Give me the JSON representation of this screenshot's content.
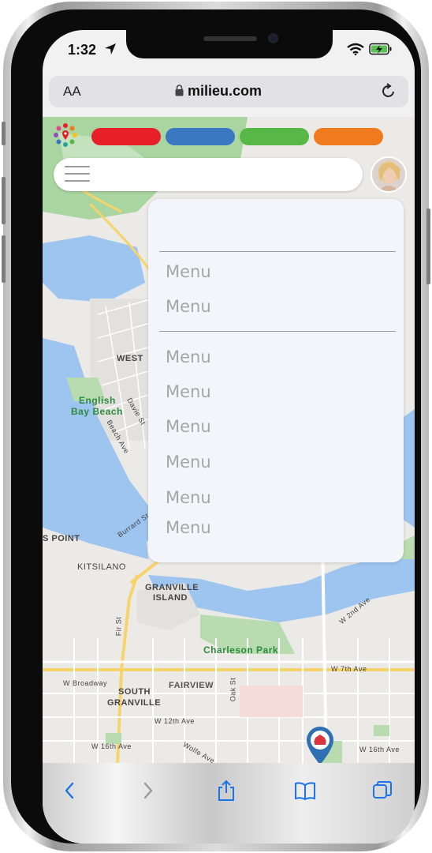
{
  "status_bar": {
    "time": "1:32",
    "icons": [
      "location-arrow-icon",
      "wifi-icon",
      "battery-charging-icon"
    ]
  },
  "browser": {
    "text_size_label": "AA",
    "url": "milieu.com",
    "icons": [
      "lock-icon",
      "reload-icon"
    ]
  },
  "app_header": {
    "logo": "milieu-logo",
    "category_tabs": [
      {
        "name": "red-tab",
        "color": "#e8202a"
      },
      {
        "name": "blue-tab",
        "color": "#3a78c2"
      },
      {
        "name": "green-tab",
        "color": "#58b847"
      },
      {
        "name": "orange-tab",
        "color": "#f07a1e"
      }
    ],
    "search_placeholder": "",
    "menu_icon": "hamburger-icon",
    "avatar": "user-avatar"
  },
  "dropdown_menu": {
    "group_1": [
      "Menu",
      "Menu"
    ],
    "group_2": [
      "Menu",
      "Menu",
      "Menu",
      "Menu",
      "Menu",
      "Menu"
    ]
  },
  "map": {
    "labels": [
      "WEST",
      "English",
      "Bay Beach",
      "Davie St",
      "Beach Ave",
      "S POINT",
      "KITSILANO",
      "Burrard St",
      "GRANVILLE",
      "ISLAND",
      "Charleson Park",
      "W Broadway",
      "SOUTH",
      "GRANVILLE",
      "FAIRVIEW",
      "W 7th Ave",
      "W 12th Ave",
      "W 16th Ave",
      "Wolfe Ave",
      "Oak St",
      "W 2nd Ave",
      "W 16th Ave",
      "Fir St"
    ],
    "marker": "map-pin-icon"
  },
  "toolbar": {
    "icons": [
      "back-icon",
      "forward-icon",
      "share-icon",
      "bookmarks-icon",
      "tabs-icon"
    ]
  }
}
